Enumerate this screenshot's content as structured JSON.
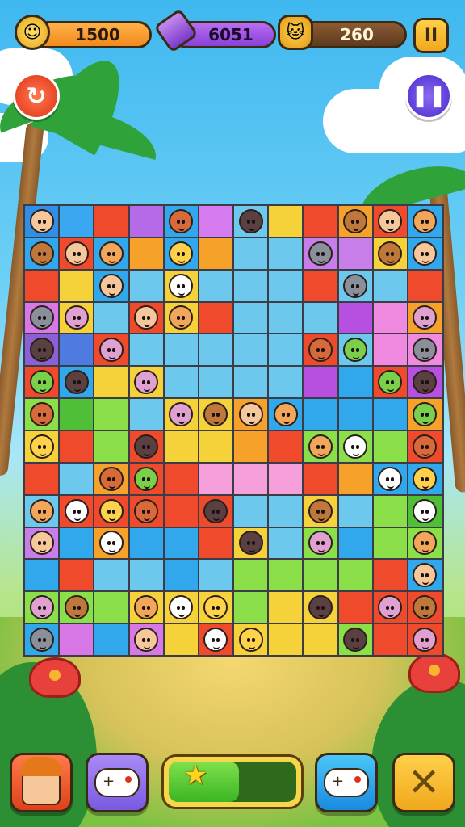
{
  "hud": {
    "coins": {
      "value": "1500",
      "icon": "coin-icon"
    },
    "gems": {
      "value": "6051",
      "icon": "potion-icon"
    },
    "cats": {
      "value": "260",
      "icon": "cat-token-icon"
    },
    "pause_label": "II"
  },
  "side_buttons": {
    "undo_icon": "undo-icon",
    "pause_icon": "pause-icon"
  },
  "board": {
    "cols": 12,
    "rows": 14,
    "cells": [
      [
        "#2f8fe8",
        "#3aa8f0",
        "#f04a2c",
        "#b56ae8",
        "#31a7ec",
        "#d67bf0",
        "#6dc8ee",
        "#f6d23a",
        "#f04a2c",
        "#f6a12a",
        "#f04a2c",
        "#31a7ec"
      ],
      [
        "#31a7ec",
        "#f04a2c",
        "#31a7ec",
        "#f6a12a",
        "#31a7ec",
        "#f6a12a",
        "#6dc8ee",
        "#6dc8ee",
        "#c77ee8",
        "#c77ee8",
        "#f6d23a",
        "#31a7ec"
      ],
      [
        "#f04a2c",
        "#f6d23a",
        "#31a7ec",
        "#6dc8ee",
        "#f6d23a",
        "#6dc8ee",
        "#6dc8ee",
        "#6dc8ee",
        "#f04a2c",
        "#6dc8ee",
        "#6dc8ee",
        "#f04a2c"
      ],
      [
        "#d877e6",
        "#f6d23a",
        "#6dc8ee",
        "#f04a2c",
        "#f6d23a",
        "#f04a2c",
        "#6dc8ee",
        "#6dc8ee",
        "#6dc8ee",
        "#b74fe0",
        "#f08ae0",
        "#f6a12a"
      ],
      [
        "#8b5fd6",
        "#4f7be0",
        "#f04a2c",
        "#6dc8ee",
        "#6dc8ee",
        "#6dc8ee",
        "#6dc8ee",
        "#6dc8ee",
        "#f04a2c",
        "#6dc8ee",
        "#f08ae0",
        "#f08ae0"
      ],
      [
        "#f04a2c",
        "#31a7ec",
        "#f6d23a",
        "#f6d23a",
        "#6dc8ee",
        "#6dc8ee",
        "#6dc8ee",
        "#6dc8ee",
        "#b74fe0",
        "#31a7ec",
        "#f04a2c",
        "#b74fe0"
      ],
      [
        "#8be04a",
        "#4fbf37",
        "#8be04a",
        "#6dc8ee",
        "#f6d23a",
        "#f6d23a",
        "#f6a12a",
        "#31a7ec",
        "#31a7ec",
        "#31a7ec",
        "#31a7ec",
        "#f6a12a"
      ],
      [
        "#f6d23a",
        "#f04a2c",
        "#8be04a",
        "#f04a2c",
        "#f6d23a",
        "#f6d23a",
        "#f6a12a",
        "#f04a2c",
        "#8be04a",
        "#8be04a",
        "#8be04a",
        "#f04a2c"
      ],
      [
        "#f04a2c",
        "#6dc8ee",
        "#f6a12a",
        "#f04a2c",
        "#f04a2c",
        "#f5a0da",
        "#f5a0da",
        "#f5a0da",
        "#f04a2c",
        "#f6a12a",
        "#31a7ec",
        "#31a7ec"
      ],
      [
        "#6dc8ee",
        "#f04a2c",
        "#f04a2c",
        "#f04a2c",
        "#f04a2c",
        "#f04a2c",
        "#6dc8ee",
        "#6dc8ee",
        "#f6d23a",
        "#6dc8ee",
        "#8be04a",
        "#4fbf37"
      ],
      [
        "#c77ee8",
        "#31a7ec",
        "#f6a12a",
        "#31a7ec",
        "#31a7ec",
        "#f04a2c",
        "#f6d23a",
        "#6dc8ee",
        "#8be04a",
        "#31a7ec",
        "#8be04a",
        "#8be04a"
      ],
      [
        "#31a7ec",
        "#f04a2c",
        "#6dc8ee",
        "#6dc8ee",
        "#31a7ec",
        "#6dc8ee",
        "#8be04a",
        "#8be04a",
        "#8be04a",
        "#8be04a",
        "#f04a2c",
        "#31a7ec"
      ],
      [
        "#8be04a",
        "#8be04a",
        "#8be04a",
        "#f6d23a",
        "#f6d23a",
        "#f6d23a",
        "#8be04a",
        "#f6d23a",
        "#f6d23a",
        "#f04a2c",
        "#f04a2c",
        "#f04a2c"
      ],
      [
        "#31a7ec",
        "#d877e6",
        "#31a7ec",
        "#d877e6",
        "#f6d23a",
        "#f04a2c",
        "#f6d23a",
        "#f6d23a",
        "#f6d23a",
        "#8be04a",
        "#f04a2c",
        "#f04a2c"
      ]
    ],
    "pieces": [
      [
        1,
        0,
        0,
        0,
        1,
        0,
        1,
        0,
        0,
        1,
        1,
        1
      ],
      [
        1,
        1,
        1,
        0,
        1,
        0,
        0,
        0,
        1,
        0,
        1,
        1
      ],
      [
        0,
        0,
        1,
        0,
        1,
        0,
        0,
        0,
        0,
        1,
        0,
        0
      ],
      [
        1,
        1,
        0,
        1,
        1,
        0,
        0,
        0,
        0,
        0,
        0,
        1
      ],
      [
        1,
        0,
        1,
        0,
        0,
        0,
        0,
        0,
        1,
        1,
        0,
        1
      ],
      [
        1,
        1,
        0,
        1,
        0,
        0,
        0,
        0,
        0,
        0,
        1,
        1
      ],
      [
        1,
        0,
        0,
        0,
        1,
        1,
        1,
        1,
        0,
        0,
        0,
        1
      ],
      [
        1,
        0,
        0,
        1,
        0,
        0,
        0,
        0,
        1,
        1,
        0,
        1
      ],
      [
        0,
        0,
        1,
        1,
        0,
        0,
        0,
        0,
        0,
        0,
        1,
        1
      ],
      [
        1,
        1,
        1,
        1,
        0,
        1,
        0,
        0,
        1,
        0,
        0,
        1
      ],
      [
        1,
        0,
        1,
        0,
        0,
        0,
        1,
        0,
        1,
        0,
        0,
        1
      ],
      [
        0,
        0,
        0,
        0,
        0,
        0,
        0,
        0,
        0,
        0,
        0,
        1
      ],
      [
        1,
        1,
        0,
        1,
        1,
        1,
        0,
        0,
        1,
        0,
        1,
        1
      ],
      [
        1,
        0,
        0,
        1,
        0,
        1,
        1,
        0,
        0,
        1,
        0,
        1
      ]
    ],
    "piece_colors": [
      "#f6c79a",
      "#8a8f9a",
      "#d86a3a",
      "#f2a65a",
      "#e0a0d0",
      "#7bd04a",
      "#ffffff",
      "#c0783a",
      "#5a4040",
      "#ffd24a"
    ]
  },
  "bottom": {
    "character_icon": "fox-girl-icon",
    "gamepad_left_icon": "gamepad-icon",
    "star_icon": "star-icon",
    "progress": 0.55,
    "gamepad_right_icon": "gamepad-icon",
    "close_icon": "close-icon"
  }
}
